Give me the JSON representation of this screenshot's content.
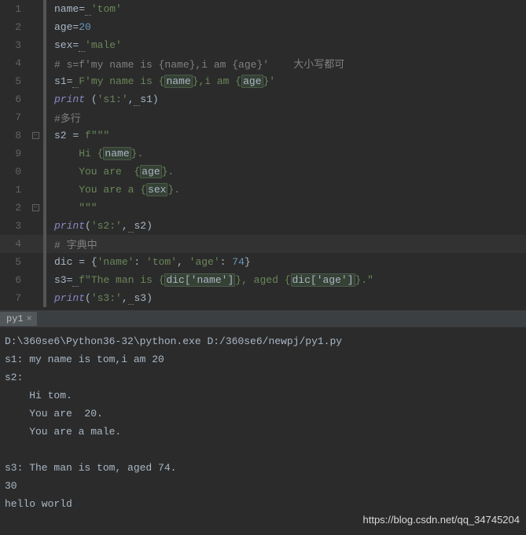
{
  "editor": {
    "lines": [
      {
        "num": "1",
        "tokens": [
          [
            "",
            "name"
          ],
          [
            "op",
            "="
          ],
          [
            "squiggle",
            " "
          ],
          [
            "str",
            "'tom'"
          ]
        ]
      },
      {
        "num": "2",
        "tokens": [
          [
            "",
            "age"
          ],
          [
            "op",
            "="
          ],
          [
            "num",
            "20"
          ]
        ]
      },
      {
        "num": "3",
        "tokens": [
          [
            "",
            "sex"
          ],
          [
            "op",
            "="
          ],
          [
            "squiggle",
            " "
          ],
          [
            "str",
            "'male'"
          ]
        ]
      },
      {
        "num": "4",
        "tokens": [
          [
            "comment",
            "# s=f'my name is {name},i am {age}'    大小写都可"
          ]
        ]
      },
      {
        "num": "5",
        "tokens": [
          [
            "",
            "s1"
          ],
          [
            "op",
            "="
          ],
          [
            "squiggle",
            " "
          ],
          [
            "str",
            "F'my name is {"
          ],
          [
            "fstr-expr",
            "name"
          ],
          [
            "str",
            "},i am {"
          ],
          [
            "fstr-expr",
            "age"
          ],
          [
            "str",
            "}'"
          ]
        ]
      },
      {
        "num": "6",
        "tokens": [
          [
            "builtin",
            "print "
          ],
          [
            "",
            "("
          ],
          [
            "str",
            "'s1:'"
          ],
          [
            "op",
            ","
          ],
          [
            "squiggle",
            " "
          ],
          [
            "",
            "s1)"
          ]
        ]
      },
      {
        "num": "7",
        "tokens": [
          [
            "comment",
            "#多行"
          ]
        ]
      },
      {
        "num": "8",
        "fold": "minus",
        "tokens": [
          [
            "",
            "s2 = "
          ],
          [
            "str",
            "f\"\"\""
          ]
        ]
      },
      {
        "num": "9",
        "tokens": [
          [
            "str",
            "    Hi {"
          ],
          [
            "fstr-expr",
            "name"
          ],
          [
            "str",
            "}."
          ]
        ]
      },
      {
        "num": "0",
        "tokens": [
          [
            "str",
            "    You are  {"
          ],
          [
            "fstr-expr",
            "age"
          ],
          [
            "str",
            "}."
          ]
        ]
      },
      {
        "num": "1",
        "tokens": [
          [
            "str",
            "    You are a {"
          ],
          [
            "fstr-expr",
            "sex"
          ],
          [
            "str",
            "}."
          ]
        ]
      },
      {
        "num": "2",
        "fold": "minusend",
        "tokens": [
          [
            "str",
            "    \"\"\""
          ]
        ]
      },
      {
        "num": "3",
        "tokens": [
          [
            "builtin",
            "print"
          ],
          [
            "",
            "("
          ],
          [
            "str",
            "'s2:'"
          ],
          [
            "op",
            ","
          ],
          [
            "squiggle",
            " "
          ],
          [
            "",
            "s2)"
          ]
        ]
      },
      {
        "num": "4",
        "highlighted": true,
        "tokens": [
          [
            "comment",
            "# 字典中"
          ]
        ]
      },
      {
        "num": "5",
        "tokens": [
          [
            "",
            "dic = {"
          ],
          [
            "str",
            "'name'"
          ],
          [
            "",
            ": "
          ],
          [
            "str",
            "'tom'"
          ],
          [
            "op",
            ", "
          ],
          [
            "str",
            "'age'"
          ],
          [
            "",
            ": "
          ],
          [
            "num",
            "74"
          ],
          [
            "",
            "}"
          ]
        ]
      },
      {
        "num": "6",
        "tokens": [
          [
            "",
            "s3"
          ],
          [
            "op",
            "="
          ],
          [
            "squiggle",
            " "
          ],
          [
            "str",
            "f\"The man is {"
          ],
          [
            "fstr-expr",
            "dic['name']"
          ],
          [
            "str",
            "}, aged {"
          ],
          [
            "fstr-expr",
            "dic['age']"
          ],
          [
            "str",
            "}.\""
          ]
        ]
      },
      {
        "num": "7",
        "tokens": [
          [
            "builtin",
            "print"
          ],
          [
            "",
            "("
          ],
          [
            "str",
            "'s3:'"
          ],
          [
            "op",
            ","
          ],
          [
            "squiggle",
            " "
          ],
          [
            "",
            "s3)"
          ]
        ]
      }
    ]
  },
  "tab": {
    "label": "py1",
    "close": "×"
  },
  "console": {
    "lines": [
      "D:\\360se6\\Python36-32\\python.exe D:/360se6/newpj/py1.py",
      "s1: my name is tom,i am 20",
      "s2: ",
      "    Hi tom.",
      "    You are  20.",
      "    You are a male.",
      "    ",
      "s3: The man is tom, aged 74.",
      "30",
      "hello world"
    ]
  },
  "watermark": "https://blog.csdn.net/qq_34745204"
}
